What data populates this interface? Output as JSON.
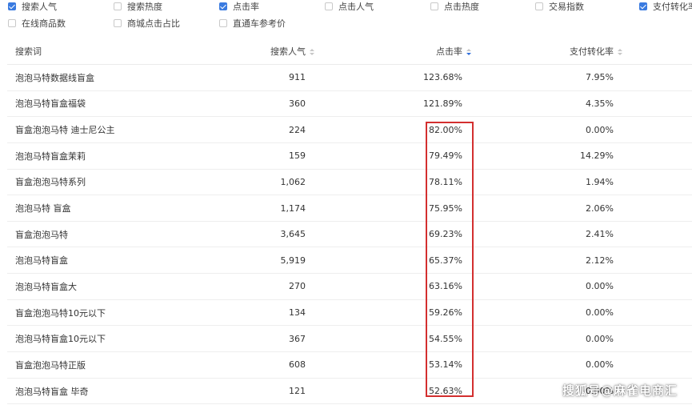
{
  "filters": [
    {
      "label": "搜索人气",
      "checked": true
    },
    {
      "label": "搜索热度",
      "checked": false
    },
    {
      "label": "点击率",
      "checked": true
    },
    {
      "label": "点击人气",
      "checked": false
    },
    {
      "label": "点击热度",
      "checked": false
    },
    {
      "label": "交易指数",
      "checked": false
    },
    {
      "label": "支付转化率",
      "checked": true
    },
    {
      "label": "在线商品数",
      "checked": false
    },
    {
      "label": "商城点击占比",
      "checked": false
    },
    {
      "label": "直通车参考价",
      "checked": false
    }
  ],
  "table": {
    "columns": {
      "keyword": "搜索词",
      "popularity": "搜索人气",
      "ctr": "点击率",
      "conversion": "支付转化率"
    },
    "sorted_by": "点击率",
    "sort_order": "desc",
    "rows": [
      {
        "keyword": "泡泡马特数据线盲盒",
        "popularity": "911",
        "ctr": "123.68%",
        "conversion": "7.95%"
      },
      {
        "keyword": "泡泡马特盲盒福袋",
        "popularity": "360",
        "ctr": "121.89%",
        "conversion": "4.35%"
      },
      {
        "keyword": "盲盒泡泡马特 迪士尼公主",
        "popularity": "224",
        "ctr": "82.00%",
        "conversion": "0.00%"
      },
      {
        "keyword": "泡泡马特盲盒茉莉",
        "popularity": "159",
        "ctr": "79.49%",
        "conversion": "14.29%"
      },
      {
        "keyword": "盲盒泡泡马特系列",
        "popularity": "1,062",
        "ctr": "78.11%",
        "conversion": "1.94%"
      },
      {
        "keyword": "泡泡马特 盲盒",
        "popularity": "1,174",
        "ctr": "75.95%",
        "conversion": "2.06%"
      },
      {
        "keyword": "盲盒泡泡马特",
        "popularity": "3,645",
        "ctr": "69.23%",
        "conversion": "2.41%"
      },
      {
        "keyword": "泡泡马特盲盒",
        "popularity": "5,919",
        "ctr": "65.37%",
        "conversion": "2.12%"
      },
      {
        "keyword": "泡泡马特盲盒大",
        "popularity": "270",
        "ctr": "63.16%",
        "conversion": "0.00%"
      },
      {
        "keyword": "盲盒泡泡马特10元以下",
        "popularity": "134",
        "ctr": "59.26%",
        "conversion": "0.00%"
      },
      {
        "keyword": "泡泡马特盲盒10元以下",
        "popularity": "367",
        "ctr": "54.55%",
        "conversion": "0.00%"
      },
      {
        "keyword": "盲盒泡泡马特正版",
        "popularity": "608",
        "ctr": "53.14%",
        "conversion": "0.00%"
      },
      {
        "keyword": "泡泡马特盲盒 毕奇",
        "popularity": "121",
        "ctr": "52.63%",
        "conversion": "0.00%"
      }
    ]
  },
  "watermark": "搜狐号@麻雀电商汇",
  "colors": {
    "accent": "#3a7be0",
    "highlight": "#d32f2f"
  }
}
